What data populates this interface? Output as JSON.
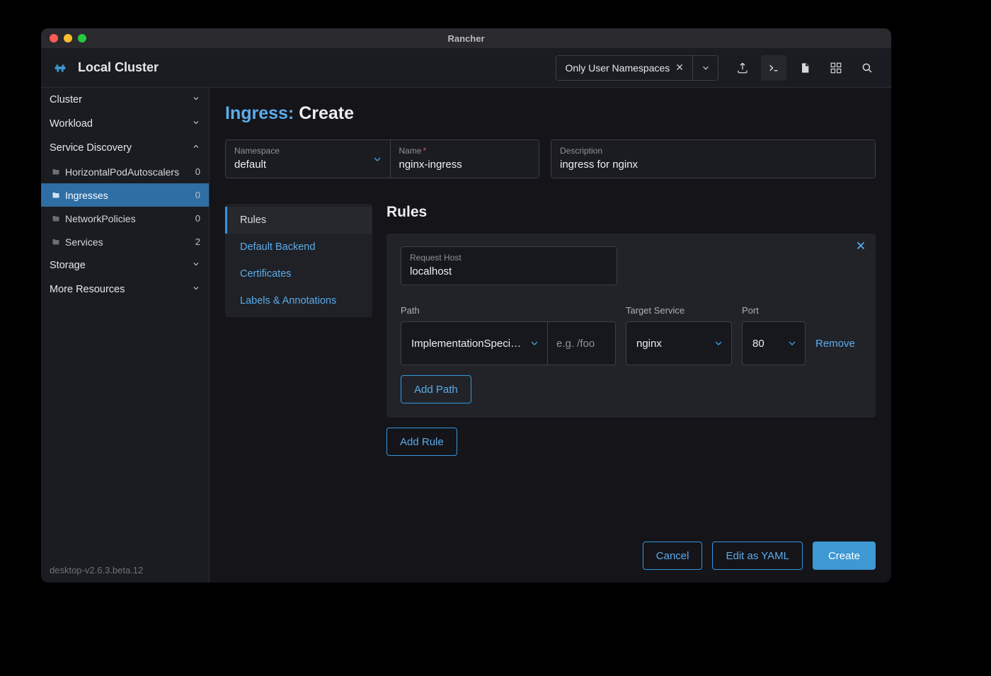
{
  "window": {
    "title": "Rancher"
  },
  "header": {
    "cluster_name": "Local Cluster",
    "namespace_filter": "Only User Namespaces"
  },
  "sidebar": {
    "groups": [
      {
        "label": "Cluster",
        "expanded": false
      },
      {
        "label": "Workload",
        "expanded": false
      },
      {
        "label": "Service Discovery",
        "expanded": true
      },
      {
        "label": "Storage",
        "expanded": false
      },
      {
        "label": "More Resources",
        "expanded": false
      }
    ],
    "service_discovery_items": [
      {
        "label": "HorizontalPodAutoscalers",
        "count": 0,
        "active": false
      },
      {
        "label": "Ingresses",
        "count": 0,
        "active": true
      },
      {
        "label": "NetworkPolicies",
        "count": 0,
        "active": false
      },
      {
        "label": "Services",
        "count": 2,
        "active": false
      }
    ],
    "version": "desktop-v2.6.3.beta.12"
  },
  "page": {
    "title_prefix": "Ingress:",
    "title_action": "Create",
    "fields": {
      "namespace_label": "Namespace",
      "namespace_value": "default",
      "name_label": "Name",
      "name_required": "*",
      "name_value": "nginx-ingress",
      "description_label": "Description",
      "description_value": "ingress for nginx"
    },
    "tabs": [
      {
        "label": "Rules",
        "active": true
      },
      {
        "label": "Default Backend",
        "active": false
      },
      {
        "label": "Certificates",
        "active": false
      },
      {
        "label": "Labels & Annotations",
        "active": false
      }
    ],
    "rules": {
      "heading": "Rules",
      "request_host_label": "Request Host",
      "request_host_value": "localhost",
      "cols": {
        "path": "Path",
        "target_service": "Target Service",
        "port": "Port"
      },
      "row": {
        "path_type": "ImplementationSpeci…",
        "path_placeholder": "e.g. /foo",
        "target_service": "nginx",
        "port": "80",
        "remove": "Remove"
      },
      "add_path": "Add Path",
      "add_rule": "Add Rule"
    },
    "footer": {
      "cancel": "Cancel",
      "edit_yaml": "Edit as YAML",
      "create": "Create"
    }
  }
}
